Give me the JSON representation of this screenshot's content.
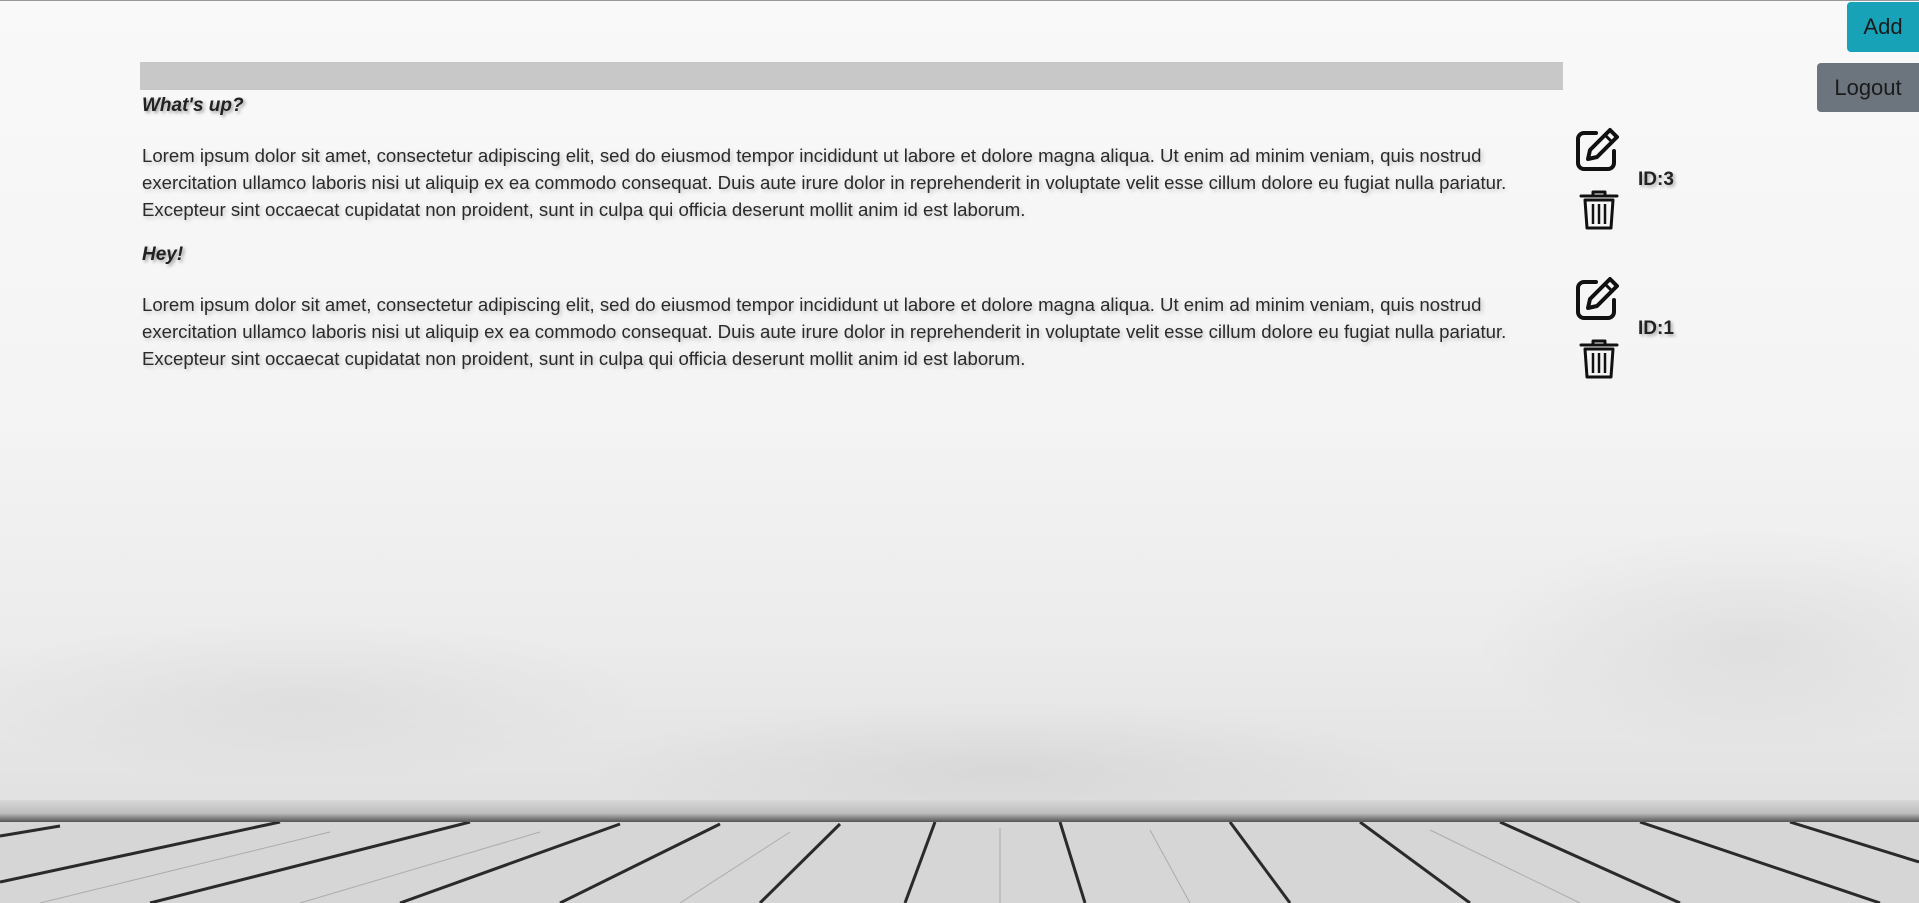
{
  "header": {
    "add_label": "Add",
    "logout_label": "Logout"
  },
  "posts": [
    {
      "title": "What's up?",
      "body": "Lorem ipsum dolor sit amet, consectetur adipiscing elit, sed do eiusmod tempor incididunt ut labore et dolore magna aliqua. Ut enim ad minim veniam, quis nostrud exercitation ullamco laboris nisi ut aliquip ex ea commodo consequat. Duis aute irure dolor in reprehenderit in voluptate velit esse cillum dolore eu fugiat nulla pariatur. Excepteur sint occaecat cupidatat non proident, sunt in culpa qui officia deserunt mollit anim id est laborum.",
      "id_label": "ID:3",
      "edit_icon": "edit-icon",
      "delete_icon": "trash-icon"
    },
    {
      "title": "Hey!",
      "body": "Lorem ipsum dolor sit amet, consectetur adipiscing elit, sed do eiusmod tempor incididunt ut labore et dolore magna aliqua. Ut enim ad minim veniam, quis nostrud exercitation ullamco laboris nisi ut aliquip ex ea commodo consequat. Duis aute irure dolor in reprehenderit in voluptate velit esse cillum dolore eu fugiat nulla pariatur. Excepteur sint occaecat cupidatat non proident, sunt in culpa qui officia deserunt mollit anim id est laborum.",
      "id_label": "ID:1",
      "edit_icon": "edit-icon",
      "delete_icon": "trash-icon"
    }
  ],
  "colors": {
    "add_button": "#17a2b8",
    "logout_button": "#6c757d",
    "header_bar": "#c8c8c8"
  }
}
